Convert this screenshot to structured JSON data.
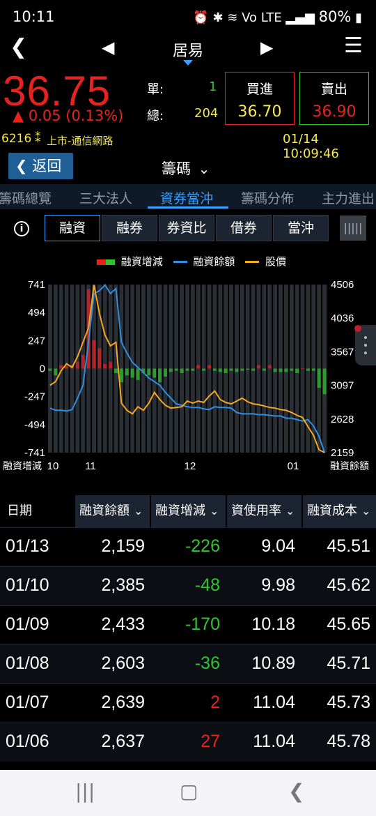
{
  "status": {
    "time": "10:11",
    "icons": "⏰ ✱ ≋ Vo LTE ▂▄▆ ",
    "battery": "80%"
  },
  "nav": {
    "title": "居易"
  },
  "quote": {
    "price": "36.75",
    "change": "▲ 0.05 (0.13%)",
    "single_label": "單:",
    "single_value": "1",
    "total_label": "總:",
    "total_value": "204",
    "buy_label": "買進",
    "buy_price": "36.70",
    "sell_label": "賣出",
    "sell_price": "36.90",
    "code": "6216",
    "market": "上市-通信網路",
    "datetime": "01/14 10:09:46"
  },
  "toolbar": {
    "back_label": "返回",
    "section_title": "籌碼"
  },
  "tabs": [
    "籌碼總覽",
    "三大法人",
    "資券當沖",
    "籌碼分佈",
    "主力進出"
  ],
  "subtabs": [
    "融資",
    "融券",
    "券資比",
    "借券",
    "當沖"
  ],
  "colors": {
    "up": "#e8231f",
    "down": "#31c431",
    "accent": "#3aa0ff",
    "balance_line": "#2f8fe0",
    "price_line": "#f5a623"
  },
  "chart_data": {
    "type": "bar+line",
    "legend": [
      "融資增減",
      "融資餘額",
      "股價"
    ],
    "left_ticks": [
      "741",
      "494",
      "247",
      "0",
      "-247",
      "-494",
      "-741"
    ],
    "right_ticks": [
      "4506",
      "4036",
      "3567",
      "3097",
      "2628",
      "2159"
    ],
    "xlabels": [
      "10",
      "11",
      "12",
      "01"
    ],
    "left_axis_title": "融資增減",
    "right_axis_title": "融資餘額",
    "left_range": [
      -741,
      741
    ],
    "right_range": [
      2159,
      4506
    ],
    "change_values": [
      -20,
      -60,
      30,
      20,
      30,
      60,
      120,
      700,
      250,
      180,
      40,
      60,
      -40,
      -120,
      -60,
      -80,
      -100,
      -40,
      -60,
      -80,
      -120,
      -70,
      -30,
      -20,
      -40,
      -20,
      -20,
      30,
      -20,
      30,
      -20,
      -30,
      -40,
      -20,
      -30,
      -20,
      -10,
      -20,
      30,
      -20,
      30,
      -30,
      -30,
      -30,
      -20,
      -40,
      2,
      -20,
      -20,
      -170,
      -226
    ],
    "balance_values": [
      2780,
      2750,
      2750,
      2740,
      2760,
      2920,
      3100,
      3700,
      4380,
      4420,
      4500,
      4380,
      4450,
      3700,
      3550,
      3420,
      3350,
      3280,
      3200,
      3150,
      3100,
      3000,
      2920,
      2840,
      2820,
      2800,
      2790,
      2790,
      2770,
      2760,
      2800,
      2790,
      2790,
      2780,
      2720,
      2700,
      2700,
      2700,
      2690,
      2690,
      2680,
      2670,
      2670,
      2640,
      2640,
      2620,
      2600,
      2620,
      2530,
      2386,
      2159
    ],
    "price_values": [
      3100,
      3150,
      3300,
      3400,
      3350,
      3500,
      3700,
      3900,
      4500,
      4100,
      3800,
      3650,
      3700,
      2850,
      2750,
      2700,
      2800,
      2750,
      2850,
      3000,
      2900,
      2820,
      2780,
      2790,
      2800,
      2880,
      2850,
      2880,
      2860,
      2950,
      3020,
      2900,
      2860,
      2840,
      2880,
      2920,
      2870,
      2840,
      2830,
      2810,
      2790,
      2780,
      2760,
      2750,
      2720,
      2680,
      2650,
      2520,
      2400,
      2200,
      2159
    ]
  },
  "table": {
    "headers": [
      "日期",
      "融資餘額",
      "融資增減",
      "資使用率",
      "融資成本"
    ],
    "rows": [
      {
        "date": "01/13",
        "balance": "2,159",
        "change": "-226",
        "usage": "9.04",
        "cost": "45.51"
      },
      {
        "date": "01/10",
        "balance": "2,385",
        "change": "-48",
        "usage": "9.98",
        "cost": "45.62"
      },
      {
        "date": "01/09",
        "balance": "2,433",
        "change": "-170",
        "usage": "10.18",
        "cost": "45.65"
      },
      {
        "date": "01/08",
        "balance": "2,603",
        "change": "-36",
        "usage": "10.89",
        "cost": "45.71"
      },
      {
        "date": "01/07",
        "balance": "2,639",
        "change": "2",
        "usage": "11.04",
        "cost": "45.73"
      },
      {
        "date": "01/06",
        "balance": "2,637",
        "change": "27",
        "usage": "11.04",
        "cost": "45.78"
      }
    ]
  }
}
